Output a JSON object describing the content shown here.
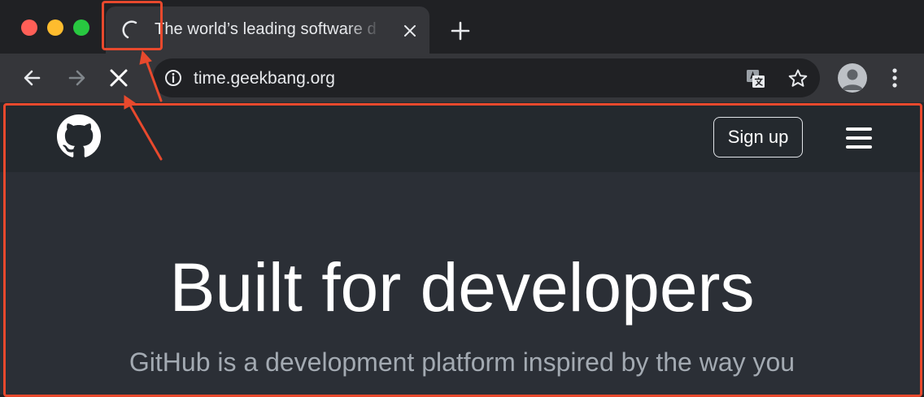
{
  "browser": {
    "tab": {
      "title": "The world’s leading software d"
    },
    "address_bar": {
      "url": "time.geekbang.org"
    },
    "colors": {
      "traffic_close": "#ff5f57",
      "traffic_minimize": "#febc2e",
      "traffic_maximize": "#28c840",
      "annotation": "#e8492d"
    }
  },
  "page": {
    "header": {
      "signup_label": "Sign up"
    },
    "hero": {
      "title": "Built for developers",
      "subtitle": "GitHub is a development platform inspired by the way you"
    }
  },
  "icons": [
    "loading-spinner-icon",
    "tab-close-icon",
    "new-tab-icon",
    "back-arrow-icon",
    "forward-arrow-icon",
    "stop-loading-icon",
    "site-info-icon",
    "translate-icon",
    "bookmark-star-icon",
    "profile-avatar-icon",
    "browser-menu-icon",
    "github-logo-icon",
    "hamburger-menu-icon"
  ]
}
